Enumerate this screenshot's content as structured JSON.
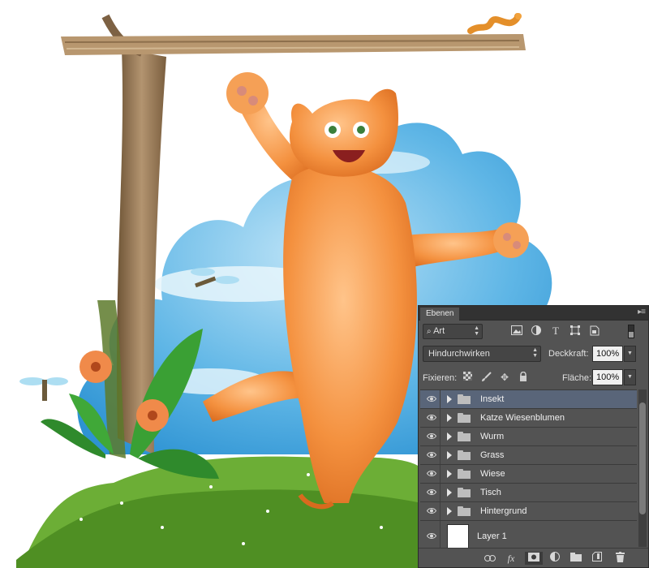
{
  "panel": {
    "tab_label": "Ebenen",
    "filter": {
      "selected": "Art"
    },
    "blend_mode": {
      "selected": "Hindurchwirken"
    },
    "opacity": {
      "label": "Deckkraft:",
      "value": "100%"
    },
    "lock": {
      "label": "Fixieren:"
    },
    "fill": {
      "label": "Fläche:",
      "value": "100%"
    },
    "layers": [
      {
        "name": "Insekt",
        "type": "group",
        "selected": true
      },
      {
        "name": "Katze Wiesenblumen",
        "type": "group",
        "selected": false
      },
      {
        "name": "Wurm",
        "type": "group",
        "selected": false
      },
      {
        "name": "Grass",
        "type": "group",
        "selected": false
      },
      {
        "name": "Wiese",
        "type": "group",
        "selected": false
      },
      {
        "name": "Tisch",
        "type": "group",
        "selected": false
      },
      {
        "name": "Hintergrund",
        "type": "group",
        "selected": false
      },
      {
        "name": "Layer 1",
        "type": "layer",
        "selected": false
      }
    ]
  },
  "colors": {
    "panel_bg": "#535353",
    "selected_row": "#596579",
    "sky": "#4aa8df",
    "cat": "#f08a3a",
    "grass": "#4f9a2a",
    "wood": "#a8855c"
  }
}
